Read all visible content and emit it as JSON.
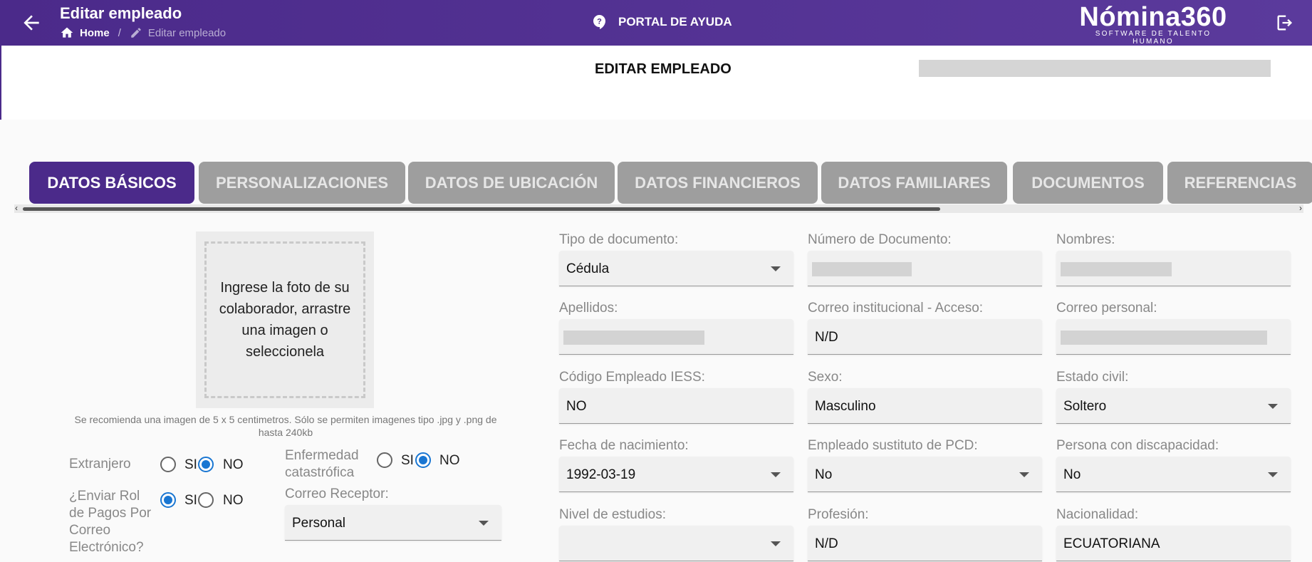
{
  "header": {
    "page_title": "Editar empleado",
    "breadcrumb_home": "Home",
    "breadcrumb_separator": "/",
    "breadcrumb_current": "Editar empleado",
    "help_label": "PORTAL DE AYUDA",
    "brand_name": "Nómina360",
    "brand_tagline": "SOFTWARE DE TALENTO HUMANO"
  },
  "section_title": "EDITAR EMPLEADO",
  "tabs": [
    {
      "label": "DATOS BÁSICOS",
      "active": true
    },
    {
      "label": "PERSONALIZACIONES"
    },
    {
      "label": "DATOS DE UBICACIÓN"
    },
    {
      "label": "DATOS FINANCIEROS"
    },
    {
      "label": "DATOS FAMILIARES"
    },
    {
      "label": "DOCUMENTOS"
    },
    {
      "label": "REFERENCIAS"
    }
  ],
  "photo": {
    "prompt": "Ingrese la foto de su colaborador, arrastre una imagen o seleccionela",
    "hint": "Se recomienda una imagen de 5 x 5 centimetros. Sólo se permiten imagenes tipo .jpg y .png de hasta 240kb"
  },
  "options": {
    "yes": "SI",
    "no": "NO"
  },
  "left_fields": {
    "extranjero": {
      "label": "Extranjero",
      "value": "NO"
    },
    "enfermedad": {
      "label": "Enfermedad catastrófica",
      "value": "NO"
    },
    "enviar_rol": {
      "label": "¿Enviar Rol de Pagos Por Correo Electrónico?",
      "value": "SI"
    },
    "correo_receptor": {
      "label": "Correo Receptor:",
      "value": "Personal"
    }
  },
  "fields": {
    "tipo_documento": {
      "label": "Tipo de documento:",
      "value": "Cédula"
    },
    "numero_documento": {
      "label": "Número de Documento:"
    },
    "nombres": {
      "label": "Nombres:"
    },
    "apellidos": {
      "label": "Apellidos:"
    },
    "correo_institucional": {
      "label": "Correo institucional - Acceso:",
      "value": "N/D"
    },
    "correo_personal": {
      "label": "Correo personal:"
    },
    "codigo_iess": {
      "label": "Código Empleado IESS:",
      "value": "NO"
    },
    "sexo": {
      "label": "Sexo:",
      "value": "Masculino"
    },
    "estado_civil": {
      "label": "Estado civil:",
      "value": "Soltero"
    },
    "fecha_nacimiento": {
      "label": "Fecha de nacimiento:",
      "value": "1992-03-19"
    },
    "sustituto_pcd": {
      "label": "Empleado sustituto de PCD:",
      "value": "No"
    },
    "discapacidad": {
      "label": "Persona con discapacidad:",
      "value": "No"
    },
    "nivel_estudios": {
      "label": "Nivel de estudios:",
      "value": ""
    },
    "profesion": {
      "label": "Profesión:",
      "value": "N/D"
    },
    "nacionalidad": {
      "label": "Nacionalidad:",
      "value": "ECUATORIANA"
    }
  },
  "colors": {
    "brand": "#4b2a8a",
    "tab_inactive": "#9e9e9e",
    "radio_selected": "#1976d2"
  },
  "icons": [
    "arrow-left-icon",
    "home-icon",
    "pencil-icon",
    "help-icon",
    "logout-icon",
    "chevron-down-icon"
  ]
}
